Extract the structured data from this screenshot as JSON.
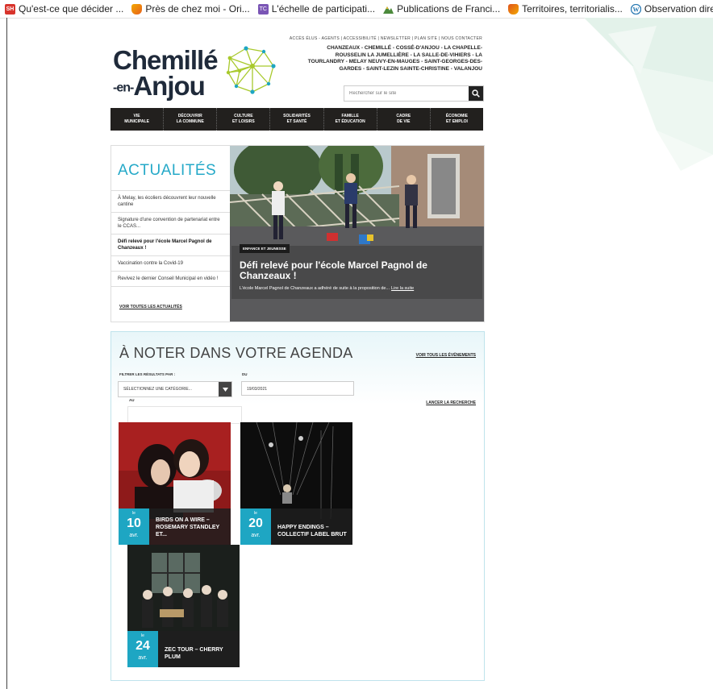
{
  "bookmarks": [
    {
      "label": "Qu'est-ce que décider ...",
      "icon": "sh-icon",
      "color": "#d8342c"
    },
    {
      "label": "Près de chez moi - Ori...",
      "icon": "bookmark-icon",
      "color": "#e8601c"
    },
    {
      "label": "L'échelle de participati...",
      "icon": "tc-icon",
      "color": "#7a55b5"
    },
    {
      "label": "Publications de Franci...",
      "icon": "mountain-icon",
      "color": "#4c8a3c"
    },
    {
      "label": "Territoires, territorialis...",
      "icon": "bookmark-icon",
      "color": "#e0531c"
    },
    {
      "label": "Observation directe et ...",
      "icon": "wordpress-icon",
      "color": "#2a7ab3"
    }
  ],
  "header": {
    "logo_line1": "Chemillé",
    "logo_line2_a": "-en-",
    "logo_line2_b": "Anjou",
    "top_links": "ACCÈS ÉLUS - AGENTS  |  ACCESSIBILITÉ  |  NEWSLETTER  |  PLAN SITE  |  NOUS CONTACTER",
    "communes": "CHANZEAUX - CHEMILLÉ - COSSÉ-D'ANJOU - LA CHAPELLE-ROUSSELIN LA JUMELLIÈRE - LA SALLE-DE-VIHIERS - LA TOURLANDRY - MELAY NEUVY-EN-MAUGES - SAINT-GEORGES-DES-GARDES - SAINT-LEZIN SAINTE-CHRISTINE - VALANJOU",
    "search_placeholder": "Rechercher sur le site"
  },
  "nav": [
    {
      "l1": "VIE",
      "l2": "MUNICIPALE"
    },
    {
      "l1": "DÉCOUVRIR",
      "l2": "LA COMMUNE"
    },
    {
      "l1": "CULTURE",
      "l2": "ET LOISIRS"
    },
    {
      "l1": "SOLIDARITÉS",
      "l2": "ET SANTÉ"
    },
    {
      "l1": "FAMILLE",
      "l2": "ET ÉDUCATION"
    },
    {
      "l1": "CADRE",
      "l2": "DE VIE"
    },
    {
      "l1": "ÉCONOMIE",
      "l2": "ET EMPLOI"
    }
  ],
  "news": {
    "title": "ACTUALITÉS",
    "items": [
      "À Melay, les écoliers découvrent leur nouvelle cantine",
      "Signature d'une convention de partenariat entre le CCAS...",
      "Défi relevé pour l'école Marcel Pagnol de Chanzeaux !",
      "Vaccination contre la Covid-19",
      "Revivez le dernier Conseil Municipal en vidéo !"
    ],
    "see_all": "VOIR TOUTES LES ACTUALITÉS",
    "featured": {
      "tag": "ENFANCE ET JEUNESSE",
      "headline": "Défi relevé pour l'école Marcel Pagnol de Chanzeaux !",
      "excerpt": "L'école Marcel Pagnol de Chanzeaux a adhéré de suite à la proposition de...",
      "read_more": "Lire la suite"
    }
  },
  "agenda": {
    "title": "À NOTER DANS VOTRE AGENDA",
    "see_all": "VOIR TOUS LES ÉVÉNEMENTS",
    "filter_label": "FILTRER LES RÉSULTATS PAR :",
    "select_value": "SÉLECTIONNEZ UNE CATÉGORIE...",
    "du_label": "DU",
    "du_value": "19/03/2021",
    "au_label": "AU",
    "launch": "LANCER LA RECHERCHE",
    "events": [
      {
        "le": "le",
        "day": "10",
        "month": "avr.",
        "title": "BIRDS ON A WIRE – ROSEMARY STANDLEY ET..."
      },
      {
        "le": "le",
        "day": "20",
        "month": "avr.",
        "title": "HAPPY ENDINGS – COLLECTIF LABEL BRUT"
      },
      {
        "le": "le",
        "day": "24",
        "month": "avr.",
        "title": "ZEC TOUR – CHERRY PLUM"
      }
    ]
  },
  "colors": {
    "accent": "#1ea6c3",
    "nav_bg": "#22201e",
    "logo_green": "#a8c92c"
  }
}
